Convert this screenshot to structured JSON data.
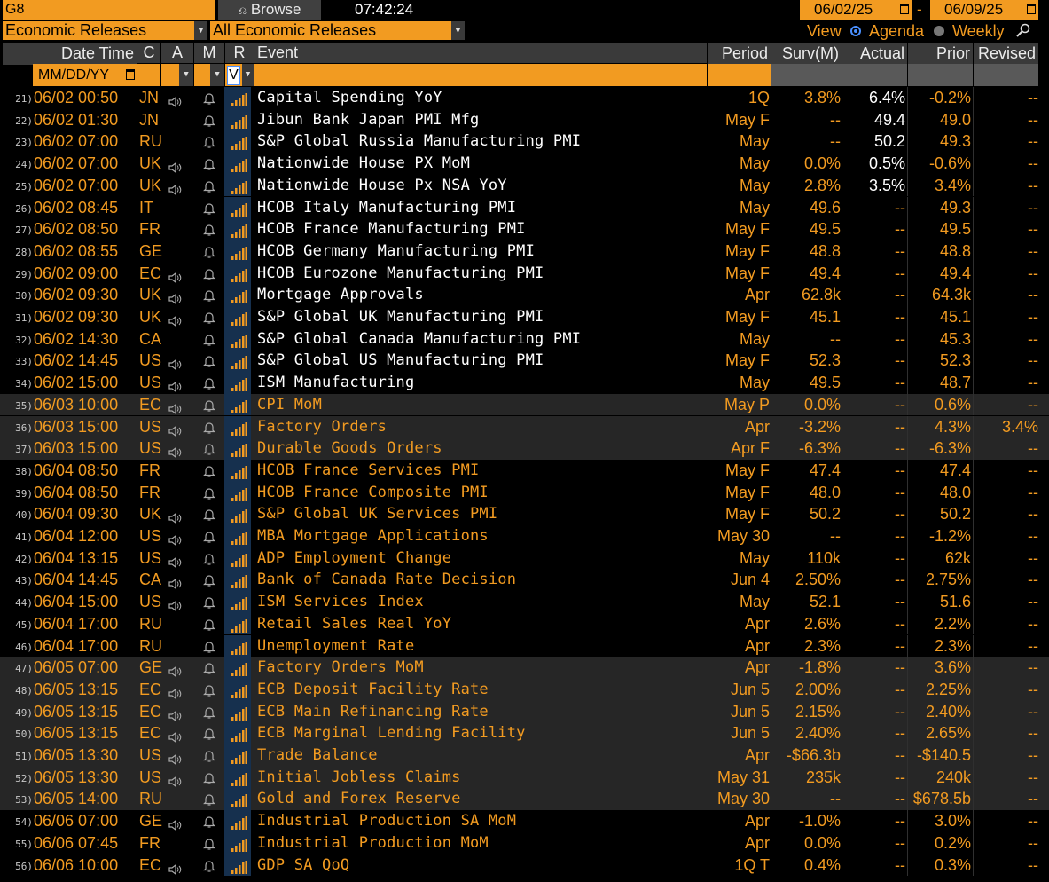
{
  "topbar": {
    "command": "G8",
    "browse_label": "Browse",
    "time": "07:42:24",
    "date_from": "06/02/25",
    "date_sep": "-",
    "date_to": "06/09/25"
  },
  "filters": {
    "category": "Economic Releases",
    "subcategory": "All Economic Releases",
    "view_label": "View",
    "view_options": [
      "Agenda",
      "Weekly"
    ],
    "view_selected": "Agenda"
  },
  "columns": {
    "datetime": "Date Time",
    "country": "C",
    "alert": "A",
    "mkt": "M",
    "relevance": "R",
    "event": "Event",
    "period": "Period",
    "survey": "Surv(M)",
    "actual": "Actual",
    "prior": "Prior",
    "revised": "Revised"
  },
  "filter_row": {
    "date_format": "MM/DD/YY",
    "relevance_value": "V"
  },
  "rows": [
    {
      "n": "21)",
      "dt": "06/02 00:50",
      "c": "JN",
      "spk": true,
      "ev": "Capital Spending YoY",
      "p": "1Q",
      "s": "3.8%",
      "a": "6.4%",
      "pr": "-0.2%",
      "rv": "--",
      "shade": false,
      "released": true
    },
    {
      "n": "22)",
      "dt": "06/02 01:30",
      "c": "JN",
      "spk": false,
      "ev": "Jibun Bank Japan PMI Mfg",
      "p": "May F",
      "s": "--",
      "a": "49.4",
      "pr": "49.0",
      "rv": "--",
      "shade": false,
      "released": true
    },
    {
      "n": "23)",
      "dt": "06/02 07:00",
      "c": "RU",
      "spk": false,
      "ev": "S&P Global Russia Manufacturing PMI",
      "p": "May",
      "s": "--",
      "a": "50.2",
      "pr": "49.3",
      "rv": "--",
      "shade": false,
      "released": true
    },
    {
      "n": "24)",
      "dt": "06/02 07:00",
      "c": "UK",
      "spk": true,
      "ev": "Nationwide House PX MoM",
      "p": "May",
      "s": "0.0%",
      "a": "0.5%",
      "pr": "-0.6%",
      "rv": "--",
      "shade": false,
      "released": true
    },
    {
      "n": "25)",
      "dt": "06/02 07:00",
      "c": "UK",
      "spk": true,
      "ev": "Nationwide House Px NSA YoY",
      "p": "May",
      "s": "2.8%",
      "a": "3.5%",
      "pr": "3.4%",
      "rv": "--",
      "shade": false,
      "released": true
    },
    {
      "n": "26)",
      "dt": "06/02 08:45",
      "c": "IT",
      "spk": false,
      "ev": "HCOB Italy Manufacturing PMI",
      "p": "May",
      "s": "49.6",
      "a": "--",
      "pr": "49.3",
      "rv": "--",
      "shade": false,
      "released": true
    },
    {
      "n": "27)",
      "dt": "06/02 08:50",
      "c": "FR",
      "spk": false,
      "ev": "HCOB France Manufacturing PMI",
      "p": "May F",
      "s": "49.5",
      "a": "--",
      "pr": "49.5",
      "rv": "--",
      "shade": false,
      "released": true
    },
    {
      "n": "28)",
      "dt": "06/02 08:55",
      "c": "GE",
      "spk": false,
      "ev": "HCOB Germany Manufacturing PMI",
      "p": "May F",
      "s": "48.8",
      "a": "--",
      "pr": "48.8",
      "rv": "--",
      "shade": false,
      "released": true
    },
    {
      "n": "29)",
      "dt": "06/02 09:00",
      "c": "EC",
      "spk": true,
      "ev": "HCOB Eurozone Manufacturing PMI",
      "p": "May F",
      "s": "49.4",
      "a": "--",
      "pr": "49.4",
      "rv": "--",
      "shade": false,
      "released": true
    },
    {
      "n": "30)",
      "dt": "06/02 09:30",
      "c": "UK",
      "spk": true,
      "ev": "Mortgage Approvals",
      "p": "Apr",
      "s": "62.8k",
      "a": "--",
      "pr": "64.3k",
      "rv": "--",
      "shade": false,
      "released": true
    },
    {
      "n": "31)",
      "dt": "06/02 09:30",
      "c": "UK",
      "spk": true,
      "ev": "S&P Global UK Manufacturing PMI",
      "p": "May F",
      "s": "45.1",
      "a": "--",
      "pr": "45.1",
      "rv": "--",
      "shade": false,
      "released": true
    },
    {
      "n": "32)",
      "dt": "06/02 14:30",
      "c": "CA",
      "spk": false,
      "ev": "S&P Global Canada Manufacturing PMI",
      "p": "May",
      "s": "--",
      "a": "--",
      "pr": "45.3",
      "rv": "--",
      "shade": false,
      "released": true
    },
    {
      "n": "33)",
      "dt": "06/02 14:45",
      "c": "US",
      "spk": true,
      "ev": "S&P Global US Manufacturing PMI",
      "p": "May F",
      "s": "52.3",
      "a": "--",
      "pr": "52.3",
      "rv": "--",
      "shade": false,
      "released": true
    },
    {
      "n": "34)",
      "dt": "06/02 15:00",
      "c": "US",
      "spk": true,
      "ev": "ISM Manufacturing",
      "p": "May",
      "s": "49.5",
      "a": "--",
      "pr": "48.7",
      "rv": "--",
      "shade": false,
      "released": true
    },
    {
      "n": "35)",
      "dt": "06/03 10:00",
      "c": "EC",
      "spk": true,
      "ev": "CPI MoM",
      "p": "May P",
      "s": "0.0%",
      "a": "--",
      "pr": "0.6%",
      "rv": "--",
      "shade": true,
      "released": false
    },
    {
      "n": "36)",
      "dt": "06/03 15:00",
      "c": "US",
      "spk": true,
      "ev": "Factory Orders",
      "p": "Apr",
      "s": "-3.2%",
      "a": "--",
      "pr": "4.3%",
      "rv": "3.4%",
      "shade": true,
      "released": false
    },
    {
      "n": "37)",
      "dt": "06/03 15:00",
      "c": "US",
      "spk": true,
      "ev": "Durable Goods Orders",
      "p": "Apr F",
      "s": "-6.3%",
      "a": "--",
      "pr": "-6.3%",
      "rv": "--",
      "shade": true,
      "released": false
    },
    {
      "n": "38)",
      "dt": "06/04 08:50",
      "c": "FR",
      "spk": false,
      "ev": "HCOB France Services PMI",
      "p": "May F",
      "s": "47.4",
      "a": "--",
      "pr": "47.4",
      "rv": "--",
      "shade": false,
      "released": false
    },
    {
      "n": "39)",
      "dt": "06/04 08:50",
      "c": "FR",
      "spk": false,
      "ev": "HCOB France Composite PMI",
      "p": "May F",
      "s": "48.0",
      "a": "--",
      "pr": "48.0",
      "rv": "--",
      "shade": false,
      "released": false
    },
    {
      "n": "40)",
      "dt": "06/04 09:30",
      "c": "UK",
      "spk": true,
      "ev": "S&P Global UK Services PMI",
      "p": "May F",
      "s": "50.2",
      "a": "--",
      "pr": "50.2",
      "rv": "--",
      "shade": false,
      "released": false
    },
    {
      "n": "41)",
      "dt": "06/04 12:00",
      "c": "US",
      "spk": true,
      "ev": "MBA Mortgage Applications",
      "p": "May 30",
      "s": "--",
      "a": "--",
      "pr": "-1.2%",
      "rv": "--",
      "shade": false,
      "released": false
    },
    {
      "n": "42)",
      "dt": "06/04 13:15",
      "c": "US",
      "spk": true,
      "ev": "ADP Employment Change",
      "p": "May",
      "s": "110k",
      "a": "--",
      "pr": "62k",
      "rv": "--",
      "shade": false,
      "released": false
    },
    {
      "n": "43)",
      "dt": "06/04 14:45",
      "c": "CA",
      "spk": true,
      "ev": "Bank of Canada Rate Decision",
      "p": "Jun 4",
      "s": "2.50%",
      "a": "--",
      "pr": "2.75%",
      "rv": "--",
      "shade": false,
      "released": false
    },
    {
      "n": "44)",
      "dt": "06/04 15:00",
      "c": "US",
      "spk": true,
      "ev": "ISM Services Index",
      "p": "May",
      "s": "52.1",
      "a": "--",
      "pr": "51.6",
      "rv": "--",
      "shade": false,
      "released": false
    },
    {
      "n": "45)",
      "dt": "06/04 17:00",
      "c": "RU",
      "spk": false,
      "ev": "Retail Sales Real YoY",
      "p": "Apr",
      "s": "2.6%",
      "a": "--",
      "pr": "2.2%",
      "rv": "--",
      "shade": false,
      "released": false
    },
    {
      "n": "46)",
      "dt": "06/04 17:00",
      "c": "RU",
      "spk": false,
      "ev": "Unemployment Rate",
      "p": "Apr",
      "s": "2.3%",
      "a": "--",
      "pr": "2.3%",
      "rv": "--",
      "shade": false,
      "released": false
    },
    {
      "n": "47)",
      "dt": "06/05 07:00",
      "c": "GE",
      "spk": true,
      "ev": "Factory Orders MoM",
      "p": "Apr",
      "s": "-1.8%",
      "a": "--",
      "pr": "3.6%",
      "rv": "--",
      "shade": true,
      "released": false
    },
    {
      "n": "48)",
      "dt": "06/05 13:15",
      "c": "EC",
      "spk": true,
      "ev": "ECB Deposit Facility Rate",
      "p": "Jun 5",
      "s": "2.00%",
      "a": "--",
      "pr": "2.25%",
      "rv": "--",
      "shade": true,
      "released": false
    },
    {
      "n": "49)",
      "dt": "06/05 13:15",
      "c": "EC",
      "spk": true,
      "ev": "ECB Main Refinancing Rate",
      "p": "Jun 5",
      "s": "2.15%",
      "a": "--",
      "pr": "2.40%",
      "rv": "--",
      "shade": true,
      "released": false
    },
    {
      "n": "50)",
      "dt": "06/05 13:15",
      "c": "EC",
      "spk": true,
      "ev": "ECB Marginal Lending Facility",
      "p": "Jun 5",
      "s": "2.40%",
      "a": "--",
      "pr": "2.65%",
      "rv": "--",
      "shade": true,
      "released": false
    },
    {
      "n": "51)",
      "dt": "06/05 13:30",
      "c": "US",
      "spk": true,
      "ev": "Trade Balance",
      "p": "Apr",
      "s": "-$66.3b",
      "a": "--",
      "pr": "-$140.5",
      "rv": "--",
      "shade": true,
      "released": false
    },
    {
      "n": "52)",
      "dt": "06/05 13:30",
      "c": "US",
      "spk": true,
      "ev": "Initial Jobless Claims",
      "p": "May 31",
      "s": "235k",
      "a": "--",
      "pr": "240k",
      "rv": "--",
      "shade": true,
      "released": false
    },
    {
      "n": "53)",
      "dt": "06/05 14:00",
      "c": "RU",
      "spk": false,
      "ev": "Gold and Forex Reserve",
      "p": "May 30",
      "s": "--",
      "a": "--",
      "pr": "$678.5b",
      "rv": "--",
      "shade": true,
      "released": false
    },
    {
      "n": "54)",
      "dt": "06/06 07:00",
      "c": "GE",
      "spk": true,
      "ev": "Industrial Production SA MoM",
      "p": "Apr",
      "s": "-1.0%",
      "a": "--",
      "pr": "3.0%",
      "rv": "--",
      "shade": false,
      "released": false
    },
    {
      "n": "55)",
      "dt": "06/06 07:45",
      "c": "FR",
      "spk": false,
      "ev": "Industrial Production MoM",
      "p": "Apr",
      "s": "0.0%",
      "a": "--",
      "pr": "0.2%",
      "rv": "--",
      "shade": false,
      "released": false
    },
    {
      "n": "56)",
      "dt": "06/06 10:00",
      "c": "EC",
      "spk": true,
      "ev": "GDP SA QoQ",
      "p": "1Q T",
      "s": "0.4%",
      "a": "--",
      "pr": "0.3%",
      "rv": "--",
      "shade": false,
      "released": false
    }
  ],
  "colors": {
    "accent": "#f29b21",
    "header_bg": "#3a3a3a",
    "shaded_row": "#262626",
    "relevance_col": "#16304e",
    "view_radio": "#4a90ff"
  }
}
